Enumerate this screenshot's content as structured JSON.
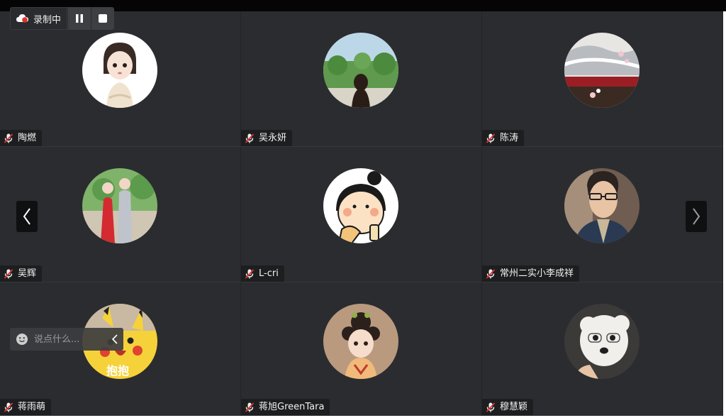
{
  "recording": {
    "status_label": "录制中",
    "icons": {
      "status": "recording-cloud-icon",
      "pause": "pause-icon",
      "stop": "stop-icon"
    }
  },
  "participants": [
    {
      "name": "陶燃",
      "avatar": "anime-girl-avatar"
    },
    {
      "name": "吴永妍",
      "avatar": "girl-in-park-avatar"
    },
    {
      "name": "陈涛",
      "avatar": "roof-blossom-avatar"
    },
    {
      "name": "吴辉",
      "avatar": "couple-photo-avatar"
    },
    {
      "name": "L-cri",
      "avatar": "cartoon-girl-avatar"
    },
    {
      "name": "常州二实小李成祥",
      "avatar": "man-glasses-avatar"
    },
    {
      "name": "蒋雨萌",
      "avatar": "pikachu-avatar"
    },
    {
      "name": "蒋旭GreenTara",
      "avatar": "chibi-hanfu-avatar"
    },
    {
      "name": "穆慧颖",
      "avatar": "white-dog-avatar"
    }
  ],
  "chat": {
    "placeholder": "说点什么..."
  },
  "pikachu_caption": "抱抱",
  "colors": {
    "stage": "#2b2c2f",
    "nametag": "#1d1e20",
    "recording_dot": "#e0322f"
  }
}
